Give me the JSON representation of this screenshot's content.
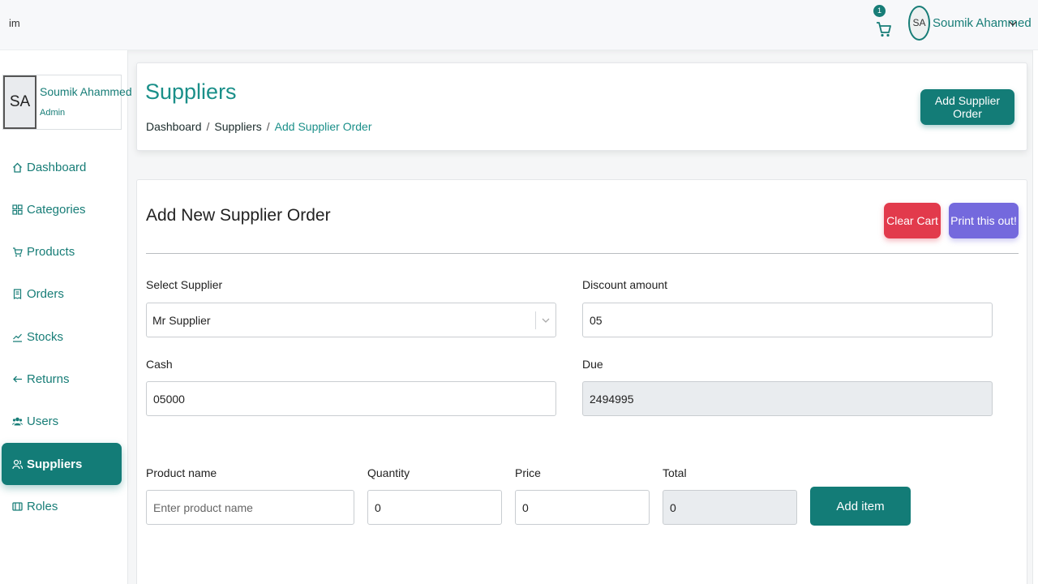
{
  "topbar": {
    "logo": "im",
    "cart_count": "1",
    "user_initials": "SA",
    "user_name": "Soumik Ahammed"
  },
  "sidebar": {
    "profile": {
      "initials": "SA",
      "name": "Soumik Ahammed",
      "role": "Admin"
    },
    "items": [
      {
        "label": "Dashboard",
        "icon": "home-icon"
      },
      {
        "label": "Categories",
        "icon": "grid-icon"
      },
      {
        "label": "Products",
        "icon": "cart-icon"
      },
      {
        "label": "Orders",
        "icon": "receipt-icon"
      },
      {
        "label": "Stocks",
        "icon": "chart-line-icon"
      },
      {
        "label": "Returns",
        "icon": "arrow-left-icon"
      },
      {
        "label": "Users",
        "icon": "users-icon"
      },
      {
        "label": "Suppliers",
        "icon": "supplier-icon",
        "active": true
      },
      {
        "label": "Roles",
        "icon": "roles-icon"
      }
    ]
  },
  "header": {
    "title": "Suppliers",
    "breadcrumb": [
      "Dashboard",
      "Suppliers",
      "Add Supplier Order"
    ],
    "add_button": "Add Supplier Order"
  },
  "form": {
    "title": "Add New Supplier Order",
    "clear_button": "Clear Cart",
    "print_button": "Print this out!",
    "supplier_label": "Select Supplier",
    "supplier_value": "Mr Supplier",
    "discount_label": "Discount amount",
    "discount_value": "05",
    "cash_label": "Cash",
    "cash_value": "05000",
    "due_label": "Due",
    "due_value": "2494995",
    "product_label": "Product name",
    "product_placeholder": "Enter product name",
    "quantity_label": "Quantity",
    "quantity_value": "0",
    "price_label": "Price",
    "price_value": "0",
    "total_label": "Total",
    "total_value": "0",
    "add_item_button": "Add item"
  },
  "colors": {
    "primary": "#137c77",
    "danger": "#e23a4c",
    "print": "#7469dd"
  }
}
